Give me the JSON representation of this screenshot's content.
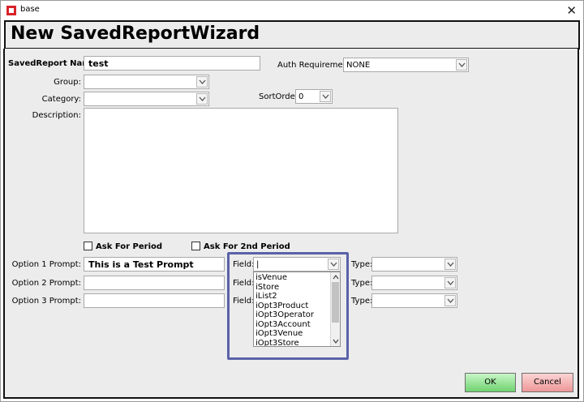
{
  "window": {
    "title": "base",
    "close_glyph": "✕"
  },
  "header": {
    "title": "New SavedReportWizard"
  },
  "form": {
    "saved_report_name": {
      "label": "SavedReport Name:",
      "value": "test"
    },
    "auth_requirement": {
      "label": "Auth Requirement:",
      "value": "NONE"
    },
    "group": {
      "label": "Group:",
      "value": ""
    },
    "category": {
      "label": "Category:",
      "value": ""
    },
    "sort_order": {
      "label": "SortOrder:",
      "value": "0"
    },
    "description": {
      "label": "Description:",
      "value": ""
    },
    "ask_for_period": {
      "label": "Ask For Period",
      "checked": false
    },
    "ask_for_2nd_period": {
      "label": "Ask For 2nd Period",
      "checked": false
    },
    "options": [
      {
        "prompt_label": "Option 1 Prompt:",
        "prompt_value": "This is a Test Prompt",
        "field_label": "Field:",
        "field_value": "|",
        "type_label": "Type:",
        "type_value": ""
      },
      {
        "prompt_label": "Option 2 Prompt:",
        "prompt_value": "",
        "field_label": "Field:",
        "field_value": "",
        "type_label": "Type:",
        "type_value": ""
      },
      {
        "prompt_label": "Option 3 Prompt:",
        "prompt_value": "",
        "field_label": "Field:",
        "field_value": "",
        "type_label": "Type:",
        "type_value": ""
      }
    ]
  },
  "field_dropdown": {
    "items": [
      "isVenue",
      "iStore",
      "iList2",
      "iOpt3Product",
      "iOpt3Operator",
      "iOpt3Account",
      "iOpt3Venue",
      "iOpt3Store"
    ]
  },
  "buttons": {
    "ok": "OK",
    "cancel": "Cancel"
  },
  "colors": {
    "highlight_border": "#5a62a9",
    "ok_green": "#6fd36f",
    "cancel_red": "#ee9797"
  }
}
